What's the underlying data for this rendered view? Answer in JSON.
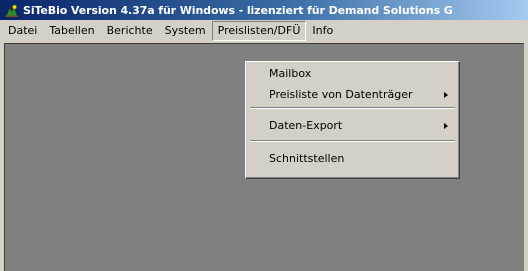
{
  "window": {
    "title": "SiTeBio Version 4.37a für Windows - lizenziert für Demand Solutions G",
    "app_icon": "sitebio-app-icon"
  },
  "menubar": {
    "items": [
      {
        "label": "Datei"
      },
      {
        "label": "Tabellen"
      },
      {
        "label": "Berichte"
      },
      {
        "label": "System"
      },
      {
        "label": "Preislisten/DFÜ",
        "active": true
      },
      {
        "label": "Info"
      }
    ]
  },
  "dropdown": {
    "items": [
      {
        "label": "Mailbox"
      },
      {
        "label": "Preisliste von Datenträger",
        "submenu": true
      },
      {
        "label": "Daten-Export",
        "submenu": true
      },
      {
        "label": "Schnittstellen"
      }
    ]
  },
  "colors": {
    "title_start": "#0a246a",
    "title_end": "#a6caf0",
    "face": "#d4d0c8",
    "client": "#808080"
  }
}
